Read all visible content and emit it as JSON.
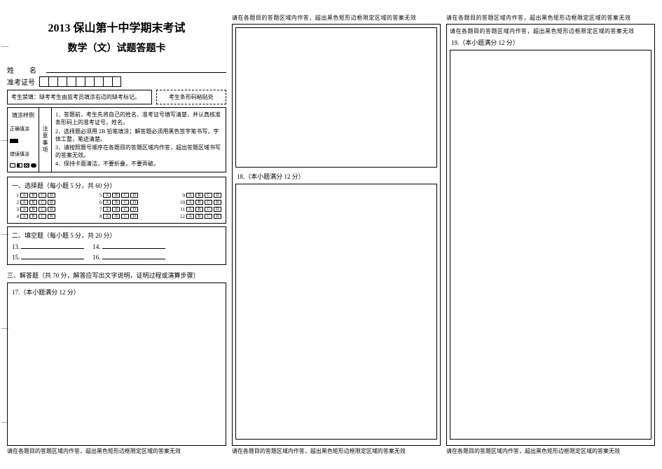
{
  "header": {
    "title_line1": "2013 保山第十中学期末考试",
    "title_line2": "数学（文）试题答题卡"
  },
  "student_info": {
    "name_label": "姓　名",
    "ticket_label": "准考证号"
  },
  "instructions": {
    "caution_box": "考生禁填：缺考考生由监考员填涂右边的缺考标记。",
    "barcode_label": "考生条形码粘贴处",
    "sample_correct_label": "正确填涂",
    "sample_wrong_label": "错误填涂",
    "sample_title": "填涂样例",
    "notice_title": "注意事项",
    "notice_items": [
      "1．答题前，考生先将自己的姓名、准考证号填写清楚，并认真核准条形码上的准考证号，姓名。",
      "2．选择题必须用 2B 铅笔填涂；解答题必须用黑色签字笔书写，字体工整，笔迹清楚。",
      "3．请按照题号顺序在各题目的答题区域内作答，超出答题区域书写的答案无效。",
      "4．保持卡面清洁，不要折叠，不要弄破。"
    ]
  },
  "sections": {
    "mc_header": "一、选择题（每小题 5 分，共 60 分）",
    "options": [
      "A",
      "B",
      "C",
      "D"
    ],
    "mc_numbers": [
      1,
      2,
      3,
      4,
      5,
      6,
      7,
      8,
      9,
      10,
      11,
      12
    ],
    "fill_header": "二、填空题（每小题 5 分，共 20 分）",
    "fill_numbers": [
      "13.",
      "14.",
      "15.",
      "16."
    ],
    "essay_header": "三、解答题（共 70 分，解答应写出文字说明，证明过程或演算步骤）"
  },
  "questions": {
    "q17": "17.（本小题满分 12 分）",
    "q18": "18.（本小题满分 12 分）",
    "q19": "19.（本小题满分 12 分）"
  },
  "warning_strip": "请在各题目的答题区域内作答，超出黑色矩形边框限定区域的答案无效"
}
